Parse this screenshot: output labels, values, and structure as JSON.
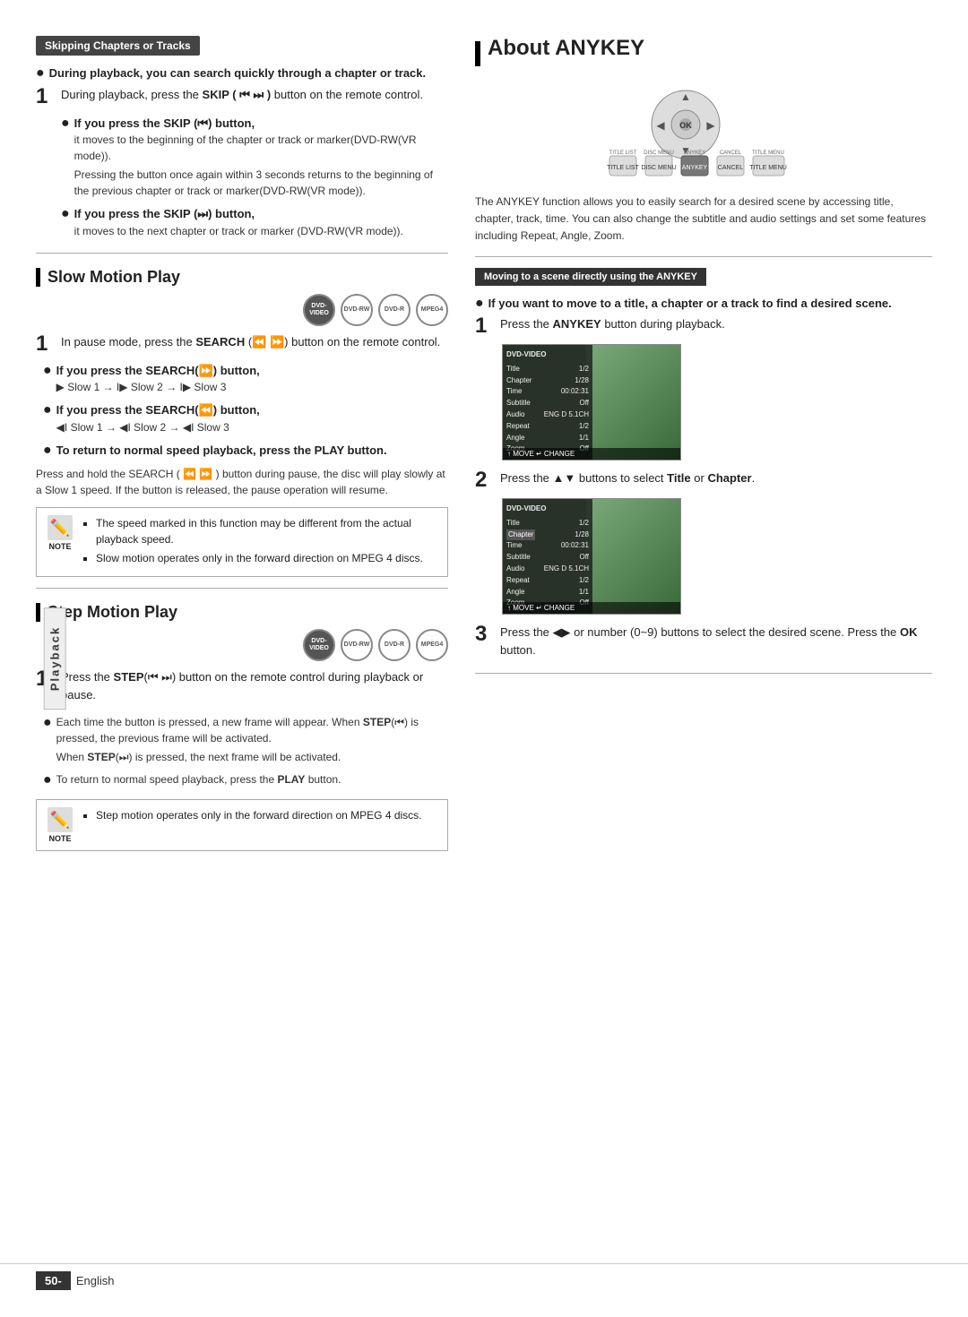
{
  "page": {
    "footer": {
      "page_number": "50",
      "language": "English"
    }
  },
  "playback_label": "Playback",
  "left_col": {
    "section1": {
      "badge": "Skipping Chapters or Tracks",
      "intro_bold": "During playback, you can search quickly through a chapter or track.",
      "step1": {
        "num": "1",
        "text_before": "During playback, press the ",
        "text_bold": "SKIP",
        "text_after": " (⏮ ⏭) button on the remote control."
      },
      "bullet1_label": "If you press the SKIP (⏮) button,",
      "bullet1_sub1": "it moves to the beginning of the chapter or track or marker(DVD-RW(VR mode)).",
      "bullet1_sub2": "Pressing the button once again within 3 seconds returns to the beginning of the previous chapter or track or marker(DVD-RW(VR mode)).",
      "bullet2_label": "If you press the SKIP (⏭) button,",
      "bullet2_sub1": "it moves to the next chapter or track or marker (DVD-RW(VR mode))."
    },
    "section_slow": {
      "title": "Slow Motion Play",
      "disc_icons": [
        {
          "label": "DVD-\nVIDEO",
          "filled": true
        },
        {
          "label": "DVD-RW",
          "filled": false
        },
        {
          "label": "DVD-R",
          "filled": false
        },
        {
          "label": "MPEG4",
          "filled": false
        }
      ],
      "step1": {
        "num": "1",
        "text_before": "In pause mode, press the ",
        "text_bold": "SEARCH",
        "text_after": " (⏪ ⏩) button on the remote control."
      },
      "bullet_search_fwd_label": "If you press the SEARCH(⏩) button,",
      "bullet_search_fwd_sub": "▶ Slow 1 → I▶ Slow 2 → I▶ Slow 3",
      "bullet_search_bwd_label": "If you press the SEARCH(⏪) button,",
      "bullet_search_bwd_sub": "◀I Slow 1 → ◀I Slow 2 → ◀I Slow 3",
      "bullet_return_label": "To return to normal speed playback, press the PLAY button.",
      "hold_text": "Press and hold the SEARCH ( ⏪ ⏩ ) button during pause, the disc will play slowly at a Slow 1 speed. If the button is released, the pause operation will resume.",
      "note": {
        "items": [
          "The speed marked in this function may be different from the actual playback speed.",
          "Slow motion operates only in the forward direction on MPEG 4 discs."
        ]
      }
    },
    "section_step": {
      "title": "Step Motion Play",
      "disc_icons": [
        {
          "label": "DVD-\nVIDEO",
          "filled": true
        },
        {
          "label": "DVD-RW",
          "filled": false
        },
        {
          "label": "DVD-R",
          "filled": false
        },
        {
          "label": "MPEG4",
          "filled": false
        }
      ],
      "step1": {
        "num": "1",
        "text_before": "Press the ",
        "text_bold": "STEP",
        "text_after": "(⏮ ⏭) button on the remote control during playback or pause."
      },
      "bullet1": "Each time the button is pressed, a new frame will appear. When STEP(⏮) is pressed, the previous frame will be activated.\nWhen STEP(⏭) is pressed, the next frame will be activated.",
      "bullet2": "To return to normal speed playback, press the PLAY button.",
      "note": {
        "items": [
          "Step motion operates only in the forward direction on MPEG 4 discs."
        ]
      }
    }
  },
  "right_col": {
    "title": "About ANYKEY",
    "anykey_desc": "The ANYKEY function allows you to easily search for a desired scene by accessing title, chapter, track, time. You can also change the subtitle and audio settings and set some features including Repeat, Angle, Zoom.",
    "moving_badge": "Moving to a scene directly using the ANYKEY",
    "intro_bold": "If you want to move to a title, a chapter or a track to find a desired scene.",
    "step1": {
      "num": "1",
      "text": "Press the ANYKEY button during playback."
    },
    "screen1": {
      "label": "DVD-VIDEO",
      "rows": [
        {
          "key": "Title",
          "val": "1/2"
        },
        {
          "key": "Chapter",
          "val": "1/28"
        },
        {
          "key": "Time",
          "val": "00:02:31"
        },
        {
          "key": "Subtitle",
          "val": "Off"
        },
        {
          "key": "Audio",
          "val": "ENG(D 5.1CH)"
        },
        {
          "key": "Repeat",
          "val": "1/2"
        },
        {
          "key": "Angle",
          "val": "1/1"
        },
        {
          "key": "Zoom",
          "val": "Off"
        }
      ],
      "bottom_bar": "↑ MOVE  ↵ CHANGE"
    },
    "step2": {
      "num": "2",
      "text_before": "Press the ▲▼ buttons to select ",
      "text_bold": "Title",
      "text_mid": " or ",
      "text_bold2": "Chapter",
      "text_after": "."
    },
    "screen2": {
      "label": "DVD-VIDEO",
      "rows": [
        {
          "key": "Title",
          "val": "1/2"
        },
        {
          "key": "Chapter",
          "val": "1/28"
        },
        {
          "key": "Time",
          "val": "00:02:31"
        },
        {
          "key": "Subtitle",
          "val": "Off"
        },
        {
          "key": "Audio",
          "val": "ENG(D 5.1CH)"
        },
        {
          "key": "Repeat",
          "val": "1/2"
        },
        {
          "key": "Angle",
          "val": "1/1"
        },
        {
          "key": "Zoom",
          "val": "Off"
        }
      ],
      "bottom_bar": "↑ MOVE  ↵ CHANGE"
    },
    "step3": {
      "num": "3",
      "text": "Press the ◀▶ or number (0~9) buttons to select the desired scene. Press the OK button."
    }
  }
}
